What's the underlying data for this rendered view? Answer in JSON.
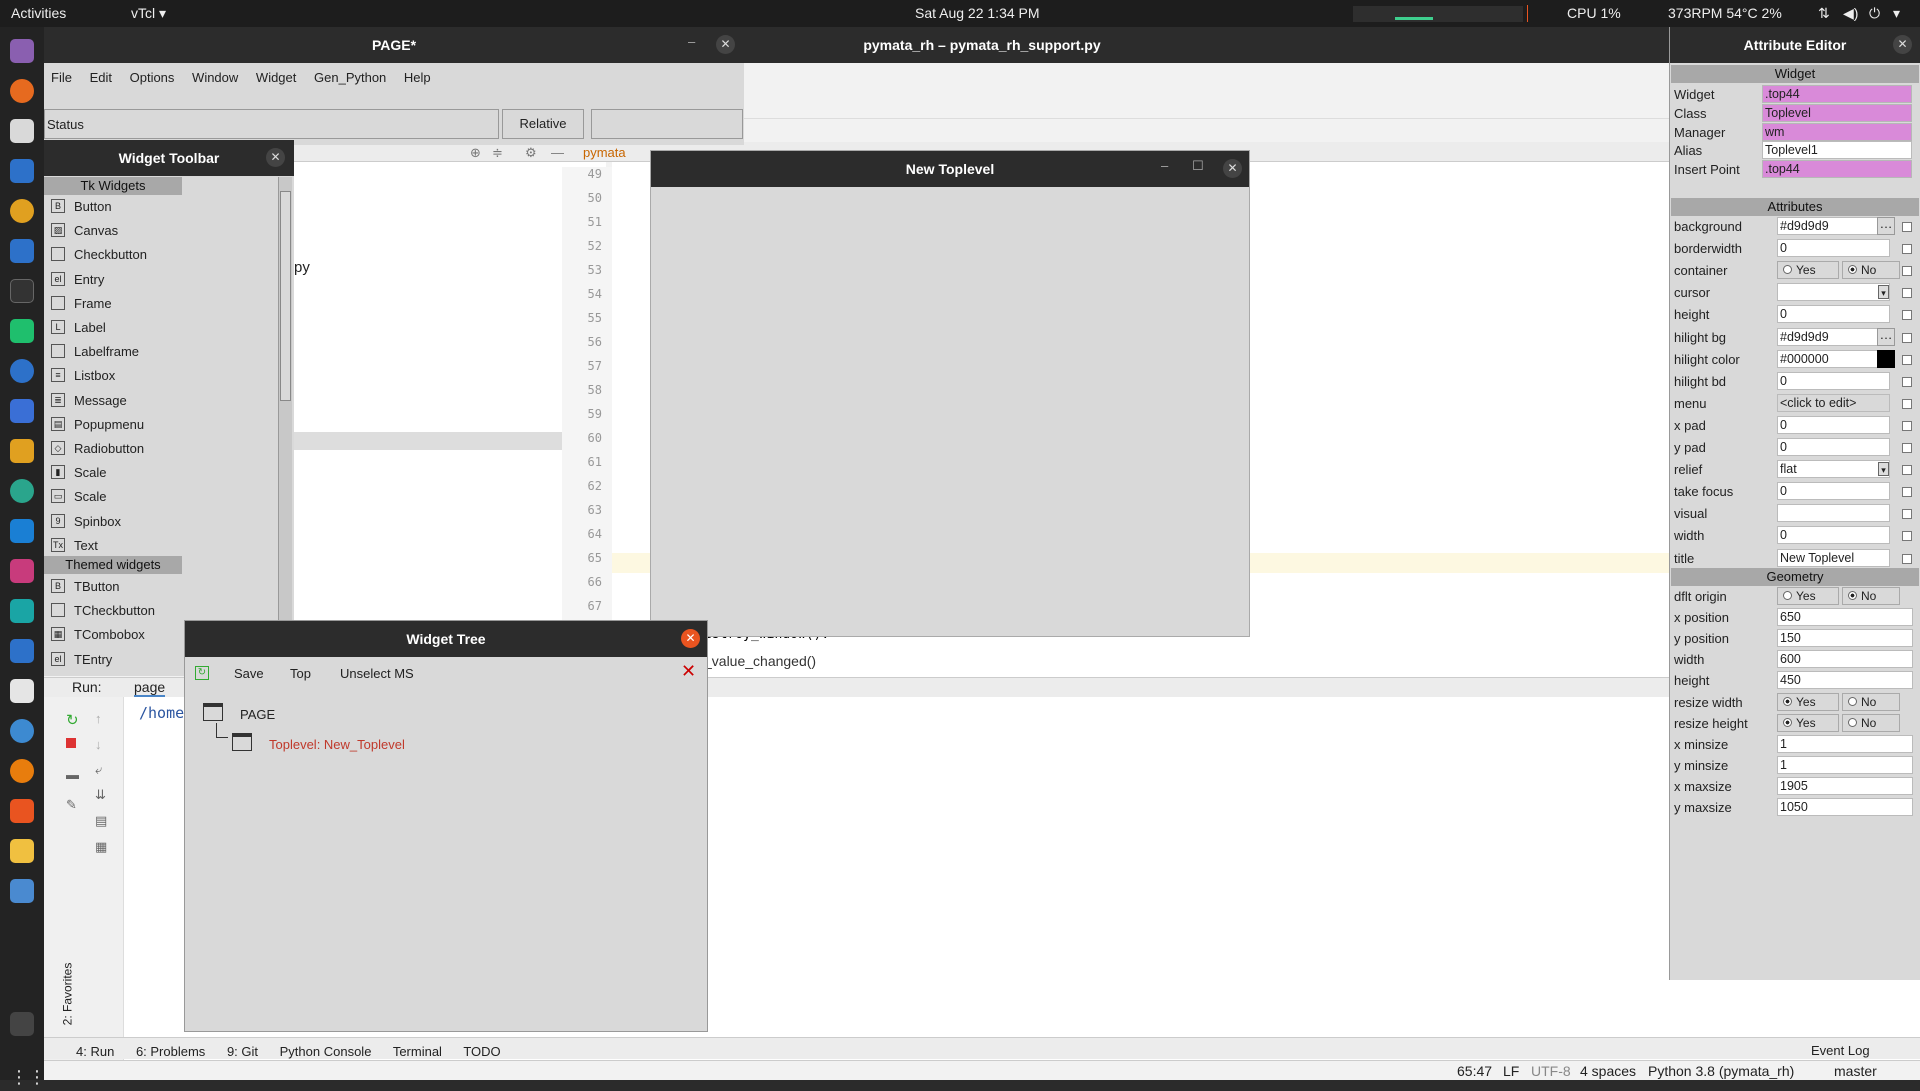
{
  "topbar": {
    "activities": "Activities",
    "app": "vTcl ▾",
    "datetime": "Sat Aug 22   1:34 PM",
    "cpu": "CPU 1%",
    "sensors": "373RPM 54°C 2%"
  },
  "ide": {
    "title": "pymata_rh – pymata_rh_support.py",
    "tab": "pymata",
    "code_frag_py": "py",
    "line_numbers": [
      "49",
      "50",
      "51",
      "52",
      "53",
      "54",
      "55",
      "56",
      "57",
      "58",
      "59",
      "60",
      "61",
      "62",
      "63",
      "64",
      "65",
      "66",
      "67"
    ],
    "code1": "estroy_window().",
    "code2": "_value_changed()",
    "run_label": "Run:",
    "run_tab": "page",
    "run_path": "/home",
    "favorites": "2: Favorites",
    "bottom_tabs": [
      "4: Run",
      "6: Problems",
      "9: Git",
      "Python Console",
      "Terminal",
      "TODO"
    ],
    "event_log": "Event Log",
    "status": {
      "pos": "65:47",
      "lf": "LF",
      "enc": "UTF-8",
      "indent": "4 spaces",
      "interp": "Python 3.8 (pymata_rh)",
      "branch": "master"
    }
  },
  "page_window": {
    "title": "PAGE*",
    "menu": [
      "File",
      "Edit",
      "Options",
      "Window",
      "Widget",
      "Gen_Python",
      "Help"
    ],
    "status_label": "Status",
    "relative": "Relative"
  },
  "widget_toolbar": {
    "title": "Widget Toolbar",
    "tk_header": "Tk Widgets",
    "tk_items": [
      {
        "icon": "B",
        "label": "Button"
      },
      {
        "icon": "▨",
        "label": "Canvas"
      },
      {
        "icon": "",
        "label": "Checkbutton"
      },
      {
        "icon": "el",
        "label": "Entry"
      },
      {
        "icon": "",
        "label": "Frame"
      },
      {
        "icon": "L",
        "label": "Label"
      },
      {
        "icon": "",
        "label": "Labelframe"
      },
      {
        "icon": "≡",
        "label": "Listbox"
      },
      {
        "icon": "≣",
        "label": "Message"
      },
      {
        "icon": "▤",
        "label": "Popupmenu"
      },
      {
        "icon": "◇",
        "label": "Radiobutton"
      },
      {
        "icon": "▮",
        "label": "Scale"
      },
      {
        "icon": "▭",
        "label": "Scale"
      },
      {
        "icon": "9",
        "label": "Spinbox"
      },
      {
        "icon": "Tx",
        "label": "Text"
      }
    ],
    "themed_header": "Themed widgets",
    "themed_items": [
      {
        "icon": "B",
        "label": "TButton"
      },
      {
        "icon": "",
        "label": "TCheckbutton"
      },
      {
        "icon": "▦",
        "label": "TCombobox"
      },
      {
        "icon": "el",
        "label": "TEntry"
      }
    ]
  },
  "new_toplevel": {
    "title": "New Toplevel"
  },
  "widget_tree": {
    "title": "Widget Tree",
    "buttons": [
      "Save",
      "Top",
      "Unselect MS"
    ],
    "root": "PAGE",
    "child": "Toplevel: New_Toplevel"
  },
  "attribute_editor": {
    "title": "Attribute Editor",
    "widget_header": "Widget",
    "widget_rows": [
      {
        "label": "Widget",
        "value": ".top44",
        "pink": true
      },
      {
        "label": "Class",
        "value": "Toplevel",
        "pink": true
      },
      {
        "label": "Manager",
        "value": "wm",
        "pink": true
      },
      {
        "label": "Alias",
        "value": "Toplevel1",
        "pink": false
      },
      {
        "label": "Insert Point",
        "value": ".top44",
        "pink": true
      }
    ],
    "attributes_header": "Attributes",
    "attr_rows": [
      {
        "label": "background",
        "value": "#d9d9d9",
        "extra": "dots"
      },
      {
        "label": "borderwidth",
        "value": "0"
      },
      {
        "label": "container",
        "value": "",
        "yes": "Yes",
        "no": "No",
        "radio": "no"
      },
      {
        "label": "cursor",
        "value": "",
        "extra": "drop"
      },
      {
        "label": "height",
        "value": "0"
      },
      {
        "label": "hilight bg",
        "value": "#d9d9d9",
        "extra": "dots"
      },
      {
        "label": "hilight color",
        "value": "#000000",
        "extra": "black"
      },
      {
        "label": "hilight bd",
        "value": "0"
      },
      {
        "label": "menu",
        "value": "<click to edit>",
        "extra": "grey"
      },
      {
        "label": "x pad",
        "value": "0"
      },
      {
        "label": "y pad",
        "value": "0"
      },
      {
        "label": "relief",
        "value": "flat",
        "extra": "drop"
      },
      {
        "label": "take focus",
        "value": "0"
      },
      {
        "label": "visual",
        "value": ""
      },
      {
        "label": "width",
        "value": "0"
      },
      {
        "label": "title",
        "value": "New Toplevel"
      }
    ],
    "geometry_header": "Geometry",
    "geom_rows": [
      {
        "label": "dflt origin",
        "radio": "no",
        "yes": "Yes",
        "no": "No"
      },
      {
        "label": "x position",
        "value": "650"
      },
      {
        "label": "y position",
        "value": "150"
      },
      {
        "label": "width",
        "value": "600"
      },
      {
        "label": "height",
        "value": "450"
      },
      {
        "label": "resize width",
        "radio": "yes",
        "yes": "Yes",
        "no": "No"
      },
      {
        "label": "resize height",
        "radio": "yes",
        "yes": "Yes",
        "no": "No"
      },
      {
        "label": "x minsize",
        "value": "1"
      },
      {
        "label": "y minsize",
        "value": "1"
      },
      {
        "label": "x maxsize",
        "value": "1905"
      },
      {
        "label": "y maxsize",
        "value": "1050"
      }
    ]
  }
}
